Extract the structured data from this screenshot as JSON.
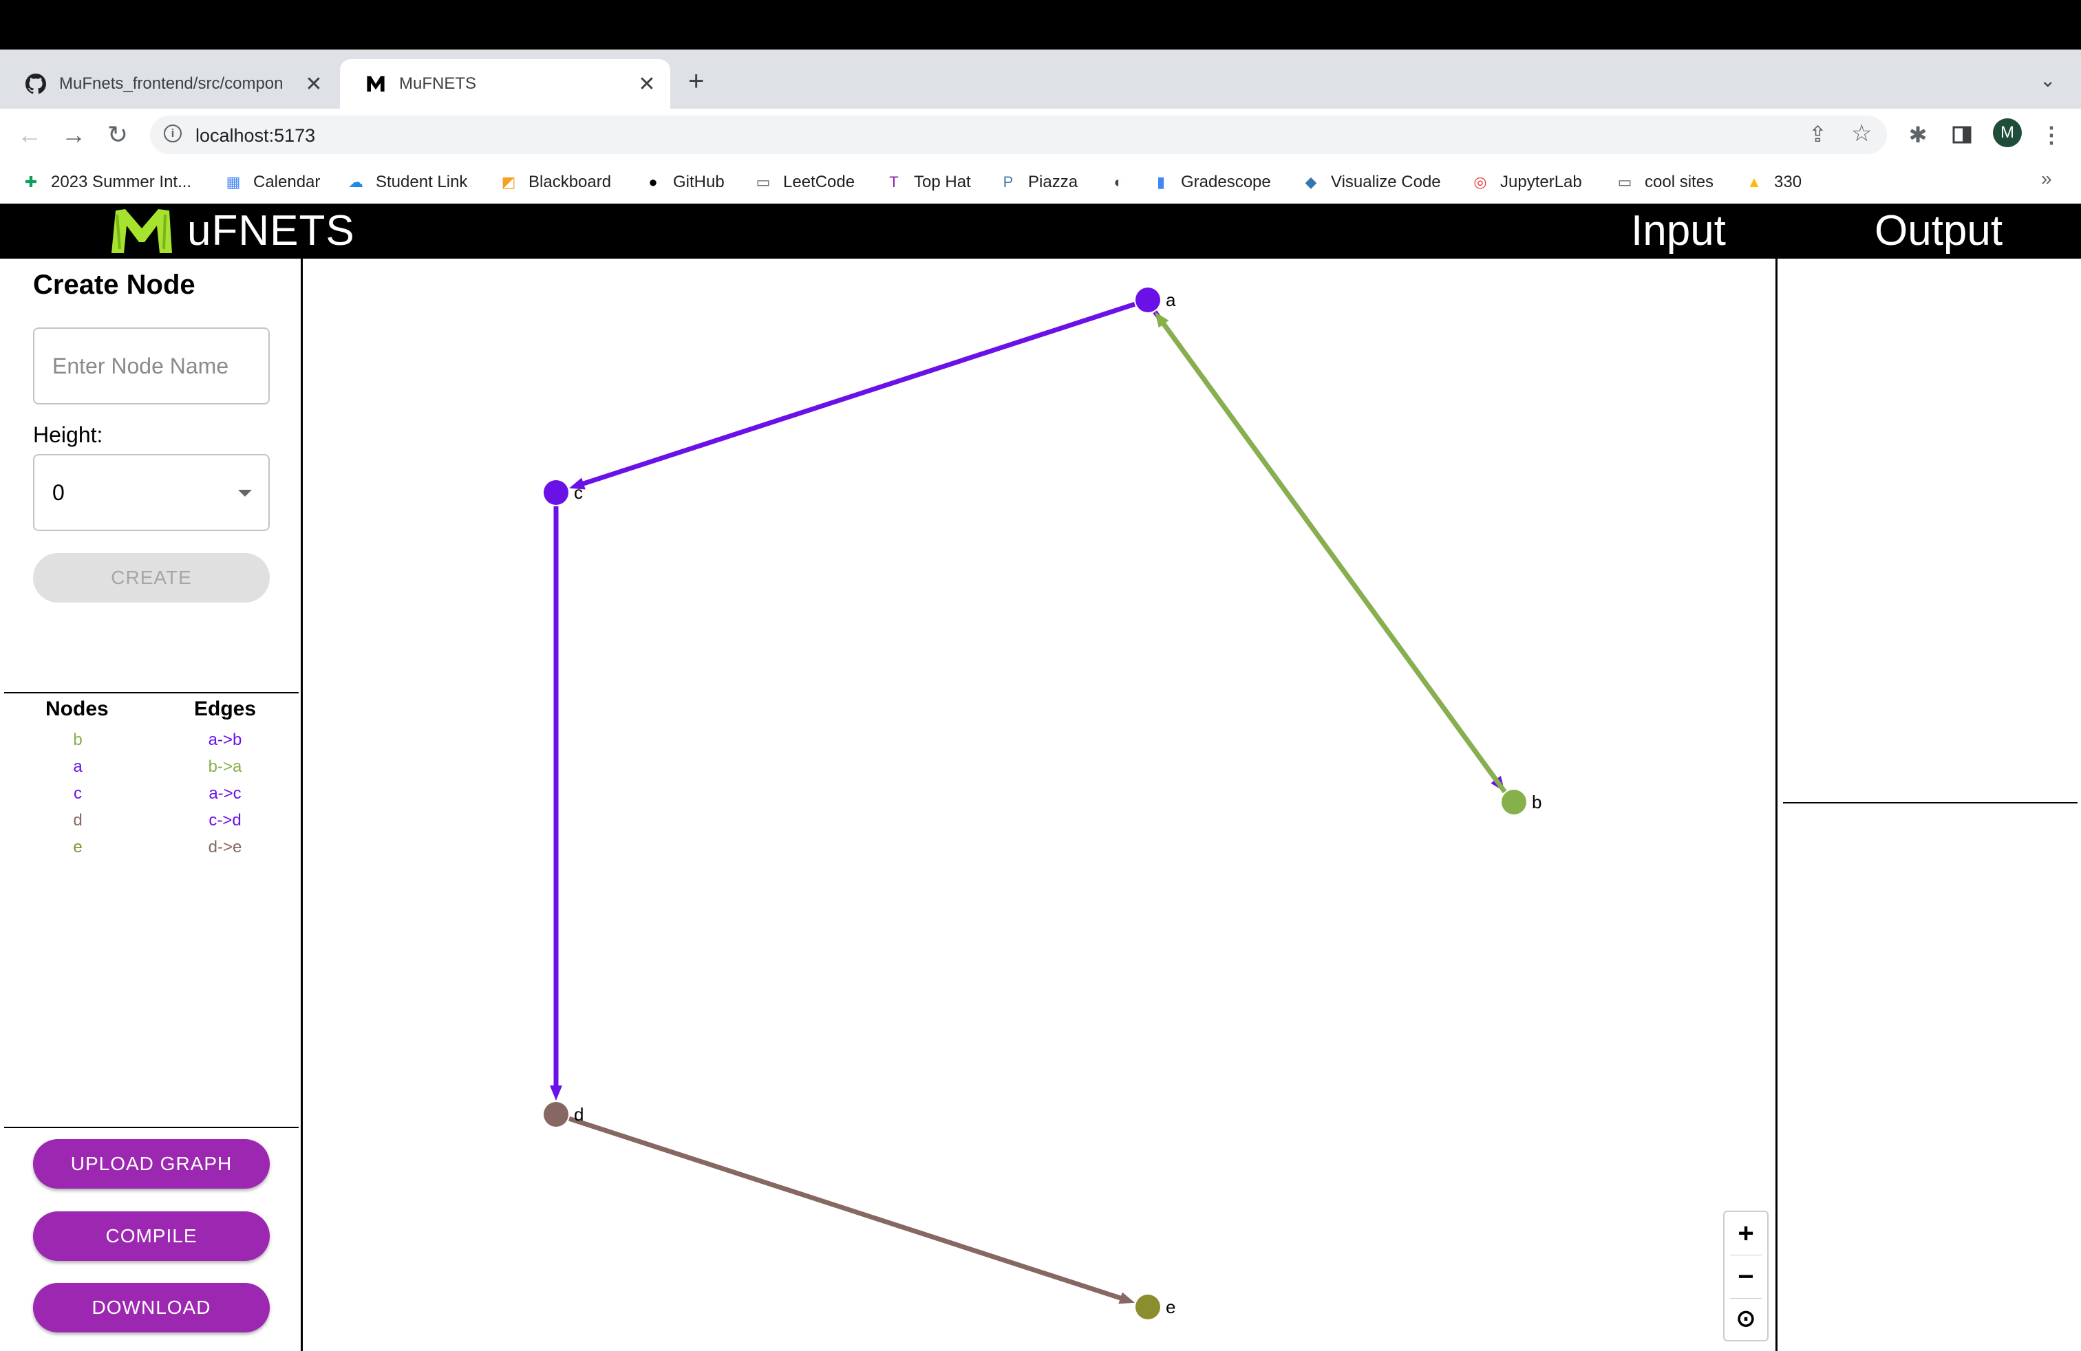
{
  "browser": {
    "tabs": [
      {
        "title": "MuFnets_frontend/src/compon",
        "favicon": "github-icon",
        "active": false
      },
      {
        "title": "MuFNETS",
        "favicon": "mufnets-icon",
        "active": true
      }
    ],
    "close_glyph": "✕",
    "new_tab_glyph": "+",
    "url": "localhost:5173",
    "profile_initial": "M",
    "bookmarks": [
      {
        "label": "2023 Summer Int...",
        "icon": "sheets-icon",
        "color": "#0f9d58"
      },
      {
        "label": "Calendar",
        "icon": "calendar-icon",
        "color": "#4285f4"
      },
      {
        "label": "Student Link",
        "icon": "cloud-icon",
        "color": "#1e88e5"
      },
      {
        "label": "Blackboard",
        "icon": "blackboard-icon",
        "color": "#f4a022"
      },
      {
        "label": "GitHub",
        "icon": "github-icon",
        "color": "#000000"
      },
      {
        "label": "LeetCode",
        "icon": "folder-icon",
        "color": "#5f6368"
      },
      {
        "label": "Top Hat",
        "icon": "tophat-icon",
        "color": "#8e24aa"
      },
      {
        "label": "Piazza",
        "icon": "piazza-icon",
        "color": "#3e7aab"
      },
      {
        "label": "",
        "icon": "globe-icon",
        "color": "#444444"
      },
      {
        "label": "Gradescope",
        "icon": "barchart-icon",
        "color": "#4285f4"
      },
      {
        "label": "Visualize Code",
        "icon": "python-icon",
        "color": "#3776ab"
      },
      {
        "label": "JupyterLab",
        "icon": "jupyter-icon",
        "color": "#e53935"
      },
      {
        "label": "cool sites",
        "icon": "folder-icon",
        "color": "#5f6368"
      },
      {
        "label": "330",
        "icon": "drive-icon",
        "color": "#fbbc04"
      }
    ],
    "more_bookmarks_glyph": "»"
  },
  "app": {
    "title": "uFNETS",
    "menu": {
      "input": "Input",
      "output": "Output"
    },
    "brand_color": "#a6e22e",
    "create_node": {
      "heading": "Create Node",
      "name_placeholder": "Enter Node Name",
      "height_label": "Height:",
      "height_value": "0",
      "create_label": "CREATE"
    },
    "lists": {
      "nodes_heading": "Nodes",
      "edges_heading": "Edges",
      "nodes": [
        {
          "label": "b",
          "color": "#86b04a"
        },
        {
          "label": "a",
          "color": "#6a11e8"
        },
        {
          "label": "c",
          "color": "#6a11e8"
        },
        {
          "label": "d",
          "color": "#866762"
        },
        {
          "label": "e",
          "color": "#8c8d2e"
        }
      ],
      "edges": [
        {
          "label": "a->b",
          "color": "#6a11e8"
        },
        {
          "label": "b->a",
          "color": "#86b04a"
        },
        {
          "label": "a->c",
          "color": "#6a11e8"
        },
        {
          "label": "c->d",
          "color": "#6a11e8"
        },
        {
          "label": "d->e",
          "color": "#866762"
        }
      ]
    },
    "actions": {
      "upload": "UPLOAD GRAPH",
      "compile": "COMPILE",
      "download": "DOWNLOAD",
      "color": "#9c27b0"
    },
    "zoom": {
      "in": "+",
      "out": "−",
      "reset": "⊙"
    }
  },
  "graph": {
    "nodes": [
      {
        "id": "a",
        "color": "#6a11e8"
      },
      {
        "id": "b",
        "color": "#86b04a"
      },
      {
        "id": "c",
        "color": "#6a11e8"
      },
      {
        "id": "d",
        "color": "#866762"
      },
      {
        "id": "e",
        "color": "#8c8d2e"
      }
    ],
    "edges": [
      {
        "from": "a",
        "to": "b",
        "color": "#6a11e8"
      },
      {
        "from": "b",
        "to": "a",
        "color": "#86b04a"
      },
      {
        "from": "a",
        "to": "c",
        "color": "#6a11e8"
      },
      {
        "from": "c",
        "to": "d",
        "color": "#6a11e8"
      },
      {
        "from": "d",
        "to": "e",
        "color": "#866762"
      }
    ]
  }
}
